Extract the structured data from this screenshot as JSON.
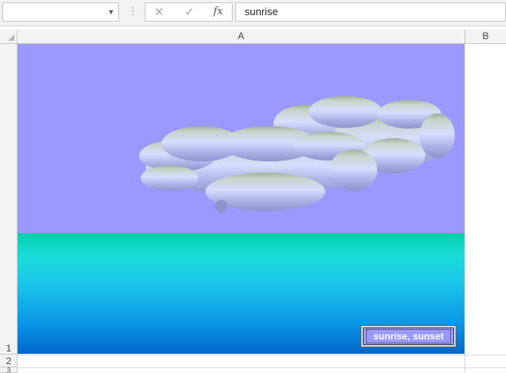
{
  "formula_bar": {
    "name_box_value": "",
    "separator_glyph": "⋮",
    "cancel_glyph": "✕",
    "enter_glyph": "✓",
    "fx_glyph": "fx",
    "formula_value": "sunrise"
  },
  "sheet": {
    "columns": [
      "A",
      "B"
    ],
    "rows": [
      "1",
      "2",
      "3"
    ]
  },
  "scene": {
    "sky_color": "#9999ff",
    "sea_colors": [
      "#00d2a8",
      "#1bc8e8",
      "#0066cc"
    ],
    "cloud_count": 2
  },
  "macro_button": {
    "label": "sunrise, sunset"
  },
  "icons": {
    "name_box_dropdown": "chevron-down-icon",
    "cancel": "close-icon",
    "enter": "check-icon",
    "function": "fx-icon",
    "select_all": "select-all-triangle-icon"
  }
}
